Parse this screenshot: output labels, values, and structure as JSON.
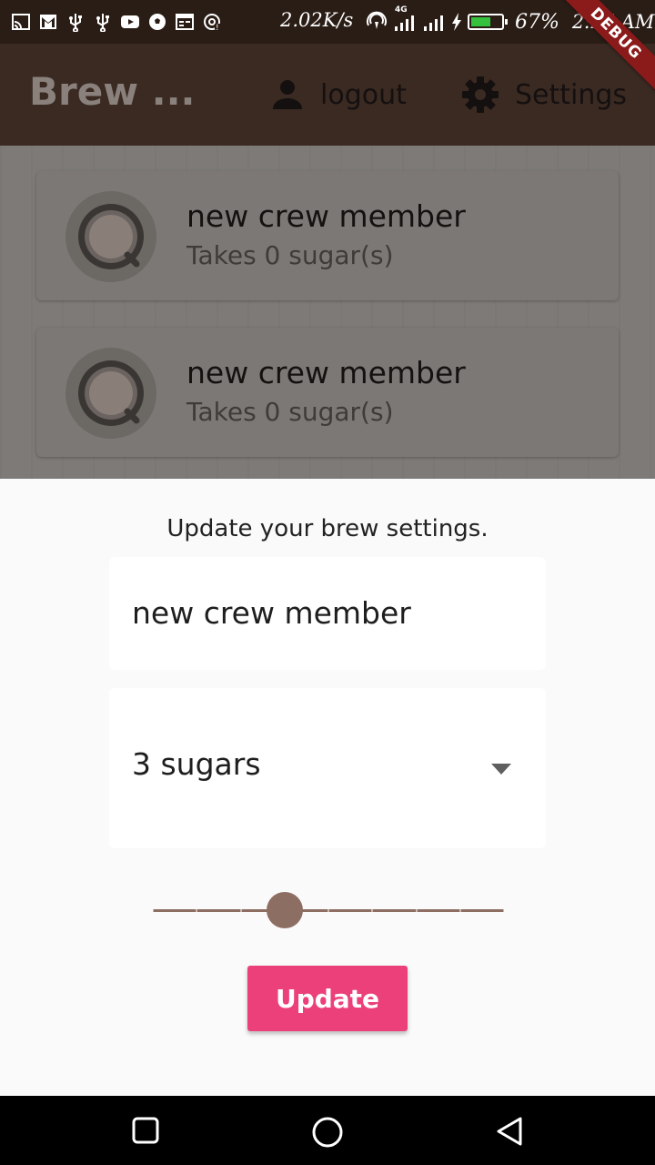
{
  "status_bar": {
    "network_speed": "2.02K/s",
    "network_type": "4G",
    "battery_level": 0.67,
    "battery_percent": "67%",
    "time": "2:25 AM",
    "left_icons": [
      "cast-icon",
      "gmail-icon",
      "usb-icon",
      "usb-icon",
      "youtube-icon",
      "soccer-ball-icon",
      "calendar-icon",
      "sync-icon"
    ],
    "debug_label": "DEBUG"
  },
  "app_bar": {
    "title": "Brew ...",
    "logout_label": "logout",
    "settings_label": "Settings",
    "logout_icon": "person-icon",
    "settings_icon": "gear-icon"
  },
  "brews": [
    {
      "name": "new crew member",
      "subtitle": "Takes 0 sugar(s)"
    },
    {
      "name": "new crew member",
      "subtitle": "Takes 0 sugar(s)"
    }
  ],
  "sheet": {
    "title": "Update your brew settings.",
    "name_value": "new crew member",
    "sugars_value": "3 sugars",
    "slider": {
      "min": 100,
      "max": 900,
      "value": 400,
      "divisions": 8
    },
    "update_label": "Update"
  },
  "colors": {
    "accent": "#ec407a",
    "brown": "#8d6e63",
    "appbar": "#3a2a22"
  }
}
